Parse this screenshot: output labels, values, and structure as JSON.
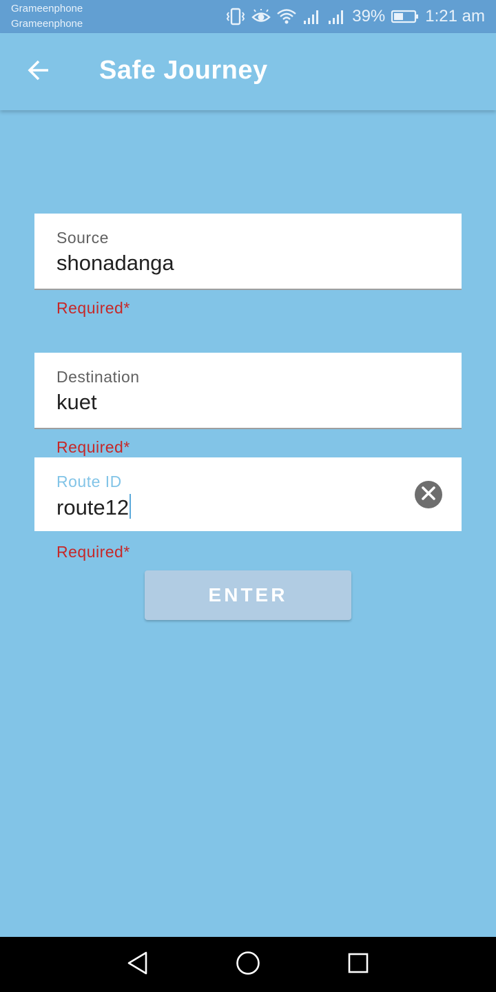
{
  "status_bar": {
    "carrier_1": "Grameenphone",
    "carrier_2": "Grameenphone",
    "battery_percent": "39%",
    "time": "1:21 am",
    "icons": [
      "vibrate-icon",
      "eye-icon",
      "wifi-icon",
      "signal-icon",
      "signal-icon",
      "battery-icon"
    ]
  },
  "app_bar": {
    "title": "Safe Journey",
    "back_icon": "arrow-left-icon"
  },
  "form": {
    "source": {
      "label": "Source",
      "value": "shonadanga",
      "error": "Required*"
    },
    "destination": {
      "label": "Destination",
      "value": "kuet",
      "error": "Required*"
    },
    "route_id": {
      "label": "Route ID",
      "value": "route12",
      "error": "Required*",
      "clear_icon": "close-circle-icon"
    },
    "enter_label": "ENTER"
  },
  "nav_bar": {
    "icons": [
      "back-triangle-icon",
      "home-circle-icon",
      "recents-square-icon"
    ]
  },
  "colors": {
    "background": "#82C4E7",
    "status_bar": "#629FD2",
    "error": "#C62828",
    "active_label": "#82C4E7",
    "button": "#B1CCE3"
  }
}
